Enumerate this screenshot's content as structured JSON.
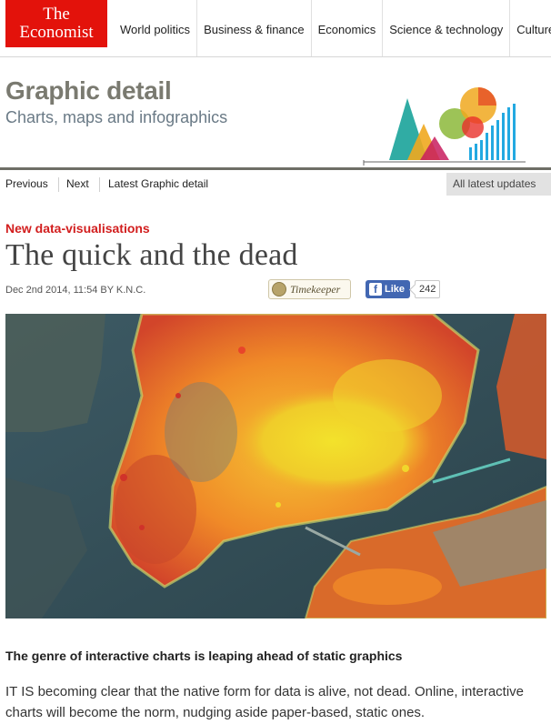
{
  "brand": {
    "line1": "The",
    "line2": "Economist",
    "color": "#e3120b"
  },
  "nav": [
    "World politics",
    "Business & finance",
    "Economics",
    "Science & technology",
    "Culture"
  ],
  "section": {
    "title": "Graphic detail",
    "subtitle": "Charts, maps and infographics"
  },
  "subnav": {
    "previous": "Previous",
    "next": "Next",
    "latest": "Latest Graphic detail",
    "all_updates": "All latest updates"
  },
  "article": {
    "rubric": "New data-visualisations",
    "headline": "The quick and the dead",
    "dateline": "Dec 2nd 2014, 11:54 BY K.N.C.",
    "standfirst": "The genre of interactive charts is leaping ahead of static graphics",
    "body": "IT IS becoming clear that the native form for data is alive, not dead. Online, interactive charts will become the norm, nudging aside paper-based, static ones."
  },
  "social": {
    "timekeeper_label": "Timekeeper",
    "like_label": "Like",
    "like_count": "242"
  },
  "colors": {
    "rubric": "#d21e1e",
    "rule": "#6e6e66",
    "facebook": "#4267b2"
  }
}
